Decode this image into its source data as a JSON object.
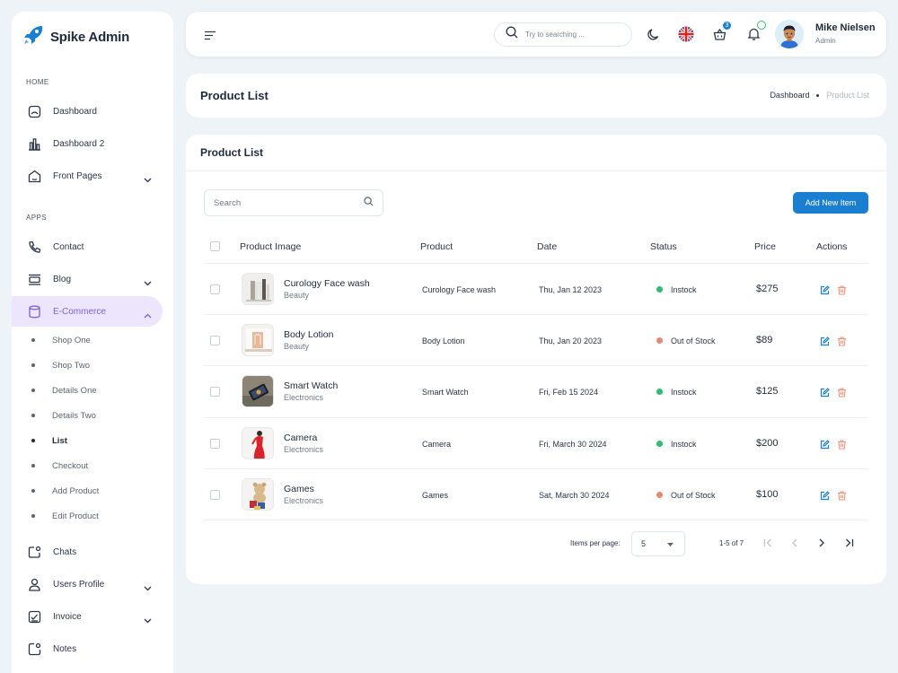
{
  "sidebar": {
    "brand": "Spike Admin",
    "sections": {
      "home": "HOME",
      "apps": "APPS"
    },
    "items": {
      "dashboard": "Dashboard",
      "dashboard2": "Dashboard 2",
      "front_pages": "Front Pages",
      "contact": "Contact",
      "blog": "Blog",
      "ecommerce": "E-Commerce",
      "chats": "Chats",
      "users_profile": "Users Profile",
      "invoice": "Invoice",
      "notes": "Notes"
    },
    "ecommerce_sub": [
      "Shop One",
      "Shop Two",
      "Details One",
      "Details Two",
      "List",
      "Checkout",
      "Add Product",
      "Edit Product"
    ],
    "active_item": "E-Commerce",
    "current_sub": "List"
  },
  "header": {
    "search_placeholder": "Try to searching ...",
    "cart_count": "3",
    "user_name": "Mike Nielsen",
    "user_role": "Admin"
  },
  "title_card": {
    "title": "Product List",
    "breadcrumb": [
      "Dashboard",
      "Product List"
    ]
  },
  "card": {
    "title": "Product List",
    "search_placeholder": "Search",
    "add_button": "Add New Item",
    "columns": [
      "Product Image",
      "Product",
      "Date",
      "Status",
      "Price",
      "Actions"
    ],
    "rows": [
      {
        "name": "Curology Face wash",
        "category": "Beauty",
        "product": "Curology Face wash",
        "date": "Thu, Jan 12 2023",
        "status": "Instock",
        "price": "$275"
      },
      {
        "name": "Body Lotion",
        "category": "Beauty",
        "product": "Body Lotion",
        "date": "Thu, Jan 20 2023",
        "status": "Out of Stock",
        "price": "$89"
      },
      {
        "name": "Smart Watch",
        "category": "Electronics",
        "product": "Smart Watch",
        "date": "Fri, Feb 15 2024",
        "status": "Instock",
        "price": "$125"
      },
      {
        "name": "Camera",
        "category": "Electronics",
        "product": "Camera",
        "date": "Fri, March 30 2024",
        "status": "Instock",
        "price": "$200"
      },
      {
        "name": "Games",
        "category": "Electronics",
        "product": "Games",
        "date": "Sat, March 30 2024",
        "status": "Out of Stock",
        "price": "$100"
      }
    ],
    "pager": {
      "items_per_page_label": "Items per page:",
      "items_per_page": "5",
      "range": "1-5 of 7"
    }
  },
  "colors": {
    "accent": "#1a7fd0",
    "active_bg": "#ece5fb",
    "active_text": "#7d5fd8",
    "instock": "#2dbd6e",
    "out_of_stock": "#e8896f",
    "edit_icon": "#1a7fd0",
    "delete_icon": "#f0957b"
  }
}
